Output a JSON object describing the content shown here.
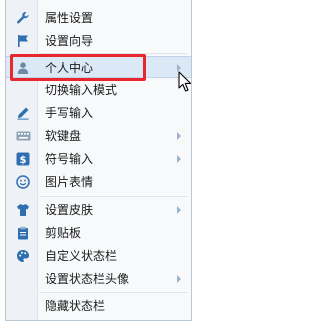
{
  "menu": {
    "items": [
      {
        "label": "属性设置",
        "icon": "wrench-icon"
      },
      {
        "label": "设置向导",
        "icon": "flag-icon"
      },
      {
        "label": "个人中心",
        "icon": "user-icon"
      },
      {
        "label": "切换输入模式",
        "icon": ""
      },
      {
        "label": "手写输入",
        "icon": "pen-icon"
      },
      {
        "label": "软键盘",
        "icon": "keyboard-icon"
      },
      {
        "label": "符号输入",
        "icon": "dollar-icon"
      },
      {
        "label": "图片表情",
        "icon": "smiley-icon"
      },
      {
        "label": "设置皮肤",
        "icon": "shirt-icon"
      },
      {
        "label": "剪贴板",
        "icon": "clipboard-icon"
      },
      {
        "label": "自定义状态栏",
        "icon": "palette-icon"
      },
      {
        "label": "设置状态栏头像",
        "icon": ""
      },
      {
        "label": "隐藏状态栏",
        "icon": ""
      }
    ]
  },
  "colors": {
    "highlight_border": "#e8262c",
    "icon_blue": "#2f6fb0",
    "hover_bg": "#dbe9f7"
  }
}
